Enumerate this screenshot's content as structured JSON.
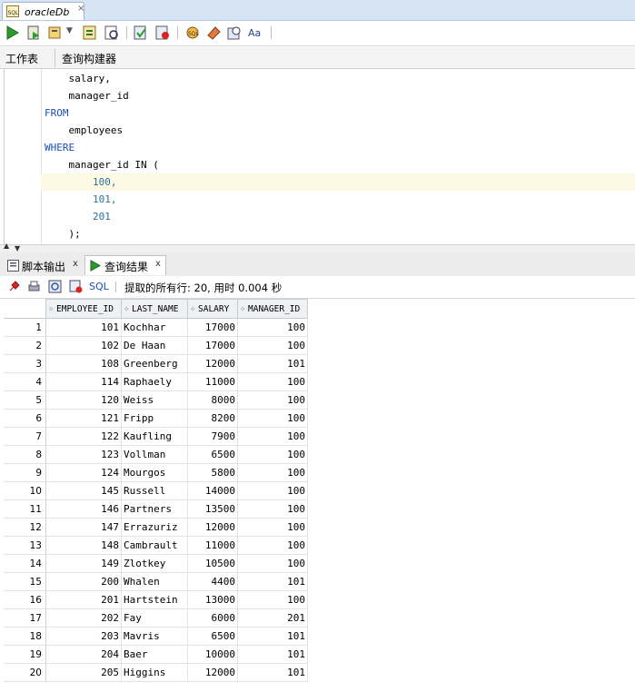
{
  "document_tab": {
    "title": "oracleDb",
    "close": "×"
  },
  "subtabs": {
    "worksheet": "工作表",
    "query_builder": "查询构建器"
  },
  "editor": {
    "lines": [
      {
        "indent": "    ",
        "text": "salary,"
      },
      {
        "indent": "    ",
        "text": "manager_id"
      },
      {
        "indent": "",
        "text": "FROM"
      },
      {
        "indent": "    ",
        "text": "employees"
      },
      {
        "indent": "",
        "text": "WHERE"
      },
      {
        "indent": "    ",
        "text": "manager_id IN ("
      },
      {
        "indent": "        ",
        "text": "100,"
      },
      {
        "indent": "        ",
        "text": "101,"
      },
      {
        "indent": "        ",
        "text": "201"
      },
      {
        "indent": "    ",
        "text": ");"
      }
    ]
  },
  "output_tabs": {
    "script_output": "脚本输出",
    "query_result": "查询结果",
    "close": "x"
  },
  "results_toolbar": {
    "sql_label": "SQL",
    "fetch_message": "提取的所有行: 20, 用时 0.004 秒"
  },
  "grid": {
    "columns": [
      "EMPLOYEE_ID",
      "LAST_NAME",
      "SALARY",
      "MANAGER_ID"
    ],
    "rows": [
      [
        "1",
        "101",
        "Kochhar",
        "17000",
        "100"
      ],
      [
        "2",
        "102",
        "De Haan",
        "17000",
        "100"
      ],
      [
        "3",
        "108",
        "Greenberg",
        "12000",
        "101"
      ],
      [
        "4",
        "114",
        "Raphaely",
        "11000",
        "100"
      ],
      [
        "5",
        "120",
        "Weiss",
        "8000",
        "100"
      ],
      [
        "6",
        "121",
        "Fripp",
        "8200",
        "100"
      ],
      [
        "7",
        "122",
        "Kaufling",
        "7900",
        "100"
      ],
      [
        "8",
        "123",
        "Vollman",
        "6500",
        "100"
      ],
      [
        "9",
        "124",
        "Mourgos",
        "5800",
        "100"
      ],
      [
        "10",
        "145",
        "Russell",
        "14000",
        "100"
      ],
      [
        "11",
        "146",
        "Partners",
        "13500",
        "100"
      ],
      [
        "12",
        "147",
        "Errazuriz",
        "12000",
        "100"
      ],
      [
        "13",
        "148",
        "Cambrault",
        "11000",
        "100"
      ],
      [
        "14",
        "149",
        "Zlotkey",
        "10500",
        "100"
      ],
      [
        "15",
        "200",
        "Whalen",
        "4400",
        "101"
      ],
      [
        "16",
        "201",
        "Hartstein",
        "13000",
        "100"
      ],
      [
        "17",
        "202",
        "Fay",
        "6000",
        "201"
      ],
      [
        "18",
        "203",
        "Mavris",
        "6500",
        "101"
      ],
      [
        "19",
        "204",
        "Baer",
        "10000",
        "101"
      ],
      [
        "20",
        "205",
        "Higgins",
        "12000",
        "101"
      ]
    ]
  },
  "colors": {
    "keyword": "#1a4fb6",
    "number": "#2c6e9e",
    "current_line": "#fdf9e2",
    "tab_strip": "#d7e4f4"
  },
  "toolbar_icons": [
    "run-statement-icon",
    "run-script-icon",
    "commit-icon",
    "dropdown-icon",
    "explain-plan-icon",
    "autotrace-icon",
    "commit-transaction-icon",
    "rollback-icon",
    "sql-tuning-icon",
    "clear-icon",
    "history-icon",
    "format-icon"
  ]
}
